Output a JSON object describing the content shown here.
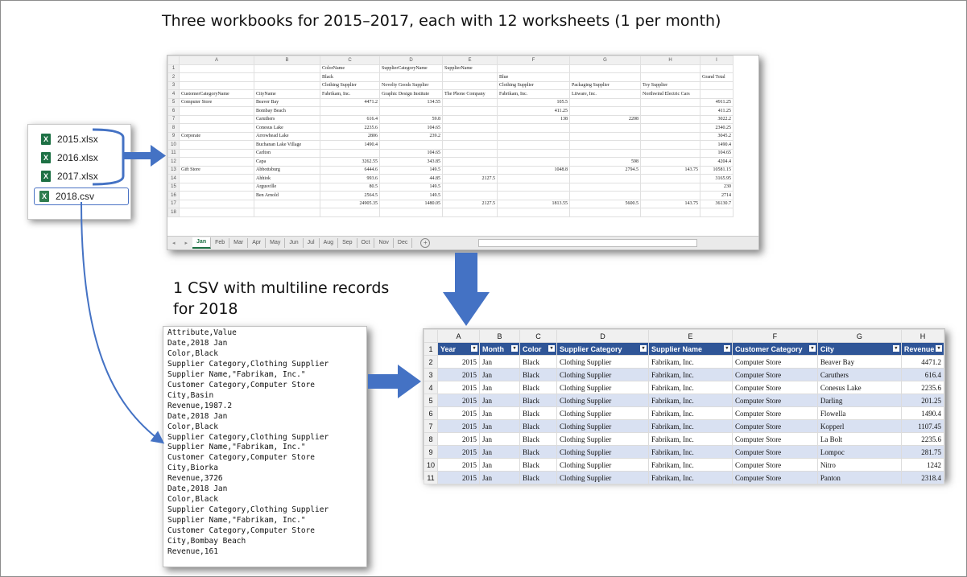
{
  "title": "Three workbooks for 2015–2017, each with 12 worksheets (1 per month)",
  "csv_heading": [
    "1 CSV with multiline records",
    "for 2018"
  ],
  "files": [
    {
      "name": "2015.xlsx",
      "icon": "excel-file-icon"
    },
    {
      "name": "2016.xlsx",
      "icon": "excel-file-icon"
    },
    {
      "name": "2017.xlsx",
      "icon": "excel-file-icon"
    },
    {
      "name": "2018.csv",
      "icon": "csv-file-icon"
    }
  ],
  "pivot": {
    "columns": [
      "A",
      "B",
      "C",
      "D",
      "E",
      "F",
      "G",
      "H",
      "I"
    ],
    "rows": [
      [
        "",
        "",
        "ColorName",
        "SupplierCategoryName",
        "SupplierName",
        "",
        "",
        "",
        ""
      ],
      [
        "",
        "",
        "Black",
        "",
        "",
        "Blue",
        "",
        "",
        "Grand Total"
      ],
      [
        "",
        "",
        "Clothing Supplier",
        "Novelty Goods Supplier",
        "",
        "Clothing Supplier",
        "Packaging Supplier",
        "Toy Supplier",
        ""
      ],
      [
        "CustomerCategoryName",
        "CityName",
        "Fabrikam, Inc.",
        "Graphic Design Institute",
        "The Phone Company",
        "Fabrikam, Inc.",
        "Litware, Inc.",
        "Northwind Electric Cars",
        ""
      ],
      [
        "Computer Store",
        "Beaver Bay",
        "4471.2",
        "134.55",
        "",
        "105.5",
        "",
        "",
        "4911.25"
      ],
      [
        "",
        "Bombay Beach",
        "",
        "",
        "",
        "411.25",
        "",
        "",
        "411.25"
      ],
      [
        "",
        "Caruthers",
        "616.4",
        "59.8",
        "",
        "138",
        "2208",
        "",
        "3022.2"
      ],
      [
        "",
        "Conesus Lake",
        "2235.6",
        "104.65",
        "",
        "",
        "",
        "",
        "2340.25"
      ],
      [
        "Corporate",
        "Arrowhead Lake",
        "2806",
        "239.2",
        "",
        "",
        "",
        "",
        "3045.2"
      ],
      [
        "",
        "Buchanan Lake Village",
        "1490.4",
        "",
        "",
        "",
        "",
        "",
        "1490.4"
      ],
      [
        "",
        "Carlton",
        "",
        "104.65",
        "",
        "",
        "",
        "",
        "104.65"
      ],
      [
        "",
        "Capa",
        "3262.55",
        "343.85",
        "",
        "",
        "598",
        "",
        "4204.4"
      ],
      [
        "Gift Store",
        "Abbottsburg",
        "6444.6",
        "149.5",
        "",
        "1048.8",
        "2794.5",
        "143.75",
        "10581.15"
      ],
      [
        "",
        "Ahhiok",
        "993.6",
        "44.85",
        "2127.5",
        "",
        "",
        "",
        "3165.95"
      ],
      [
        "",
        "Argusville",
        "80.5",
        "149.5",
        "",
        "",
        "",
        "",
        "230"
      ],
      [
        "",
        "Ben Arnold",
        "2564.5",
        "149.5",
        "",
        "",
        "",
        "",
        "2714"
      ],
      [
        "",
        "",
        "24905.35",
        "1480.05",
        "2127.5",
        "1813.55",
        "5600.5",
        "143.75",
        "36130.7"
      ],
      [
        "",
        "",
        "",
        "",
        "",
        "",
        "",
        "",
        ""
      ]
    ],
    "tabs": [
      "Jan",
      "Feb",
      "Mar",
      "Apr",
      "May",
      "Jun",
      "Jul",
      "Aug",
      "Sep",
      "Oct",
      "Nov",
      "Dec"
    ],
    "active_tab": "Jan"
  },
  "csv_lines": [
    "Attribute,Value",
    "Date,2018 Jan",
    "Color,Black",
    "Supplier Category,Clothing Supplier",
    "Supplier Name,\"Fabrikam, Inc.\"",
    "Customer Category,Computer Store",
    "City,Basin",
    "Revenue,1987.2",
    "Date,2018 Jan",
    "Color,Black",
    "Supplier Category,Clothing Supplier",
    "Supplier Name,\"Fabrikam, Inc.\"",
    "Customer Category,Computer Store",
    "City,Biorka",
    "Revenue,3726",
    "Date,2018 Jan",
    "Color,Black",
    "Supplier Category,Clothing Supplier",
    "Supplier Name,\"Fabrikam, Inc.\"",
    "Customer Category,Computer Store",
    "City,Bombay Beach",
    "Revenue,161"
  ],
  "table": {
    "columns": [
      "A",
      "B",
      "C",
      "D",
      "E",
      "F",
      "G",
      "H"
    ],
    "headers": [
      "Year",
      "Month",
      "Color",
      "Supplier Category",
      "Supplier Name",
      "Customer Category",
      "City",
      "Revenue"
    ],
    "rows": [
      [
        "2015",
        "Jan",
        "Black",
        "Clothing Supplier",
        "Fabrikam, Inc.",
        "Computer Store",
        "Beaver Bay",
        "4471.2"
      ],
      [
        "2015",
        "Jan",
        "Black",
        "Clothing Supplier",
        "Fabrikam, Inc.",
        "Computer Store",
        "Caruthers",
        "616.4"
      ],
      [
        "2015",
        "Jan",
        "Black",
        "Clothing Supplier",
        "Fabrikam, Inc.",
        "Computer Store",
        "Conesus Lake",
        "2235.6"
      ],
      [
        "2015",
        "Jan",
        "Black",
        "Clothing Supplier",
        "Fabrikam, Inc.",
        "Computer Store",
        "Darling",
        "201.25"
      ],
      [
        "2015",
        "Jan",
        "Black",
        "Clothing Supplier",
        "Fabrikam, Inc.",
        "Computer Store",
        "Flowella",
        "1490.4"
      ],
      [
        "2015",
        "Jan",
        "Black",
        "Clothing Supplier",
        "Fabrikam, Inc.",
        "Computer Store",
        "Kopperl",
        "1107.45"
      ],
      [
        "2015",
        "Jan",
        "Black",
        "Clothing Supplier",
        "Fabrikam, Inc.",
        "Computer Store",
        "La Bolt",
        "2235.6"
      ],
      [
        "2015",
        "Jan",
        "Black",
        "Clothing Supplier",
        "Fabrikam, Inc.",
        "Computer Store",
        "Lompoc",
        "281.75"
      ],
      [
        "2015",
        "Jan",
        "Black",
        "Clothing Supplier",
        "Fabrikam, Inc.",
        "Computer Store",
        "Nitro",
        "1242"
      ],
      [
        "2015",
        "Jan",
        "Black",
        "Clothing Supplier",
        "Fabrikam, Inc.",
        "Computer Store",
        "Panton",
        "2318.4"
      ]
    ]
  },
  "colors": {
    "arrow": "#4472c4",
    "table_header": "#2f5597",
    "band": "#d9e1f2",
    "excel_green": "#1d7044"
  }
}
